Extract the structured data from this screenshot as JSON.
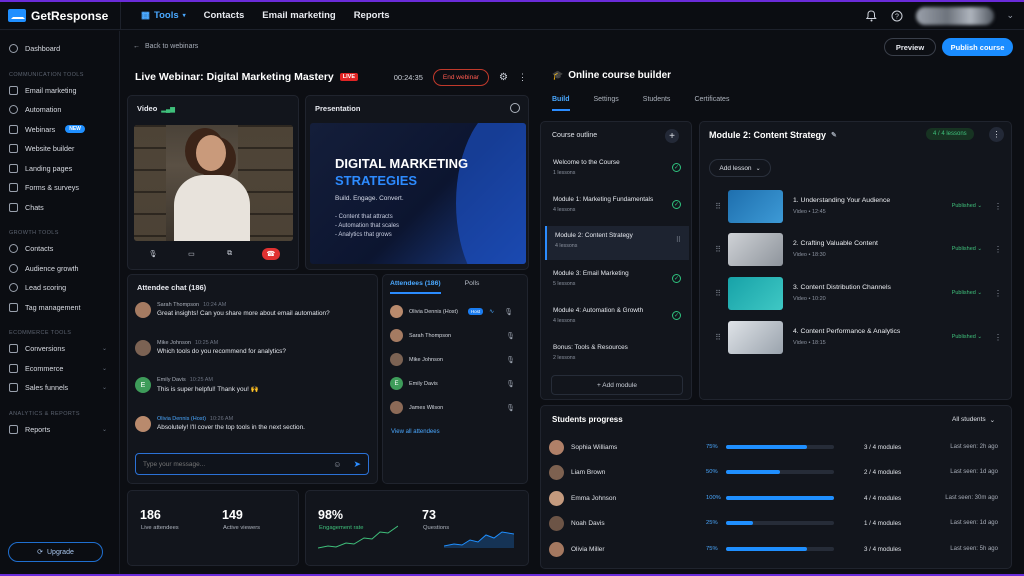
{
  "brand": {
    "name": "GetResponse"
  },
  "nav": {
    "tools": "Tools",
    "contacts": "Contacts",
    "email": "Email marketing",
    "reports": "Reports"
  },
  "sidebar": {
    "dashboard": "Dashboard",
    "section_comm": "COMMUNICATION TOOLS",
    "comm": [
      "Email marketing",
      "Automation",
      "Webinars",
      "Website builder",
      "Landing pages",
      "Forms & surveys",
      "Chats"
    ],
    "new_badge": "NEW",
    "section_growth": "GROWTH TOOLS",
    "growth": [
      "Contacts",
      "Audience growth",
      "Lead scoring",
      "Tag management"
    ],
    "section_commerce": "ECOMMERCE TOOLS",
    "commerce": [
      "Conversions",
      "Ecommerce",
      "Sales funnels"
    ],
    "section_analytics": "ANALYTICS & REPORTS",
    "analytics": [
      "Reports"
    ],
    "upgrade": "Upgrade"
  },
  "header": {
    "back": "Back to webinars",
    "preview": "Preview",
    "publish": "Publish course"
  },
  "webinar": {
    "title": "Live Webinar: Digital Marketing Mastery",
    "live": "LIVE",
    "timer": "00:24:35",
    "end": "End webinar",
    "video_label": "Video",
    "presentation_label": "Presentation",
    "slide": {
      "line1": "DIGITAL MARKETING",
      "line2": "STRATEGIES",
      "sub": "Build. Engage. Convert.",
      "bullets": [
        "- Content that attracts",
        "- Automation that scales",
        "- Analytics that grows"
      ]
    }
  },
  "chat": {
    "title": "Attendee chat (186)",
    "messages": [
      {
        "name": "Sarah Thompson",
        "time": "10:24 AM",
        "text": "Great insights! Can you share more about email automation?"
      },
      {
        "name": "Mike Johnson",
        "time": "10:25 AM",
        "text": "Which tools do you recommend for analytics?"
      },
      {
        "name": "Emily Davis",
        "time": "10:25 AM",
        "text": "This is super helpful! Thank you! 🙌"
      },
      {
        "name": "Olivia Dennis (Host)",
        "time": "10:26 AM",
        "text": "Absolutely! I'll cover the top tools in the next section."
      }
    ],
    "placeholder": "Type your message..."
  },
  "attendees": {
    "tab_attendees": "Attendees (186)",
    "tab_polls": "Polls",
    "list": [
      "Olivia Dennis (Host)",
      "Sarah Thompson",
      "Mike Johnson",
      "Emily Davis",
      "James Wilson"
    ],
    "host_tag": "Host",
    "initial": "E",
    "view_all": "View all attendees"
  },
  "stats": [
    {
      "value": "186",
      "label": "Live attendees"
    },
    {
      "value": "149",
      "label": "Active viewers"
    },
    {
      "value": "98%",
      "label": "Engagement rate"
    },
    {
      "value": "73",
      "label": "Questions"
    }
  ],
  "course": {
    "title": "Online course builder",
    "tabs": [
      "Build",
      "Settings",
      "Students",
      "Certificates"
    ],
    "outline_title": "Course outline",
    "outline": [
      {
        "title": "Welcome to the Course",
        "sub": "1 lessons",
        "state": "done"
      },
      {
        "title": "Module 1: Marketing Fundamentals",
        "sub": "4 lessons",
        "state": "done"
      },
      {
        "title": "Module 2: Content Strategy",
        "sub": "4 lessons",
        "state": "selected"
      },
      {
        "title": "Module 3: Email Marketing",
        "sub": "5 lessons",
        "state": "done"
      },
      {
        "title": "Module 4: Automation & Growth",
        "sub": "4 lessons",
        "state": "done"
      },
      {
        "title": "Bonus: Tools & Resources",
        "sub": "2 lessons",
        "state": "none"
      }
    ],
    "add_module": "+ Add module",
    "module_title": "Module 2: Content Strategy",
    "module_badge": "4 / 4 lessons",
    "add_lesson": "Add lesson",
    "lessons": [
      {
        "title": "1. Understanding Your Audience",
        "sub": "Video • 12:45",
        "status": "Published"
      },
      {
        "title": "2. Crafting Valuable Content",
        "sub": "Video • 18:30",
        "status": "Published"
      },
      {
        "title": "3. Content Distribution Channels",
        "sub": "Video • 10:20",
        "status": "Published"
      },
      {
        "title": "4. Content Performance & Analytics",
        "sub": "Video • 18:15",
        "status": "Published"
      }
    ]
  },
  "progress": {
    "title": "Students progress",
    "filter": "All students",
    "rows": [
      {
        "name": "Sophia Williams",
        "pct": "75%",
        "value": 0.75,
        "modules": "3 / 4 modules",
        "seen": "Last seen: 2h ago"
      },
      {
        "name": "Liam Brown",
        "pct": "50%",
        "value": 0.5,
        "modules": "2 / 4 modules",
        "seen": "Last seen: 1d ago"
      },
      {
        "name": "Emma Johnson",
        "pct": "100%",
        "value": 1.0,
        "modules": "4 / 4 modules",
        "seen": "Last seen: 30m ago"
      },
      {
        "name": "Noah Davis",
        "pct": "25%",
        "value": 0.25,
        "modules": "1 / 4 modules",
        "seen": "Last seen: 1d ago"
      },
      {
        "name": "Olivia Miller",
        "pct": "75%",
        "value": 0.75,
        "modules": "3 / 4 modules",
        "seen": "Last seen: 5h ago"
      }
    ]
  },
  "colors": {
    "accent": "#1f8fff",
    "live": "#e02424",
    "success": "#3fc07b",
    "frame": "#6a2bd9"
  }
}
